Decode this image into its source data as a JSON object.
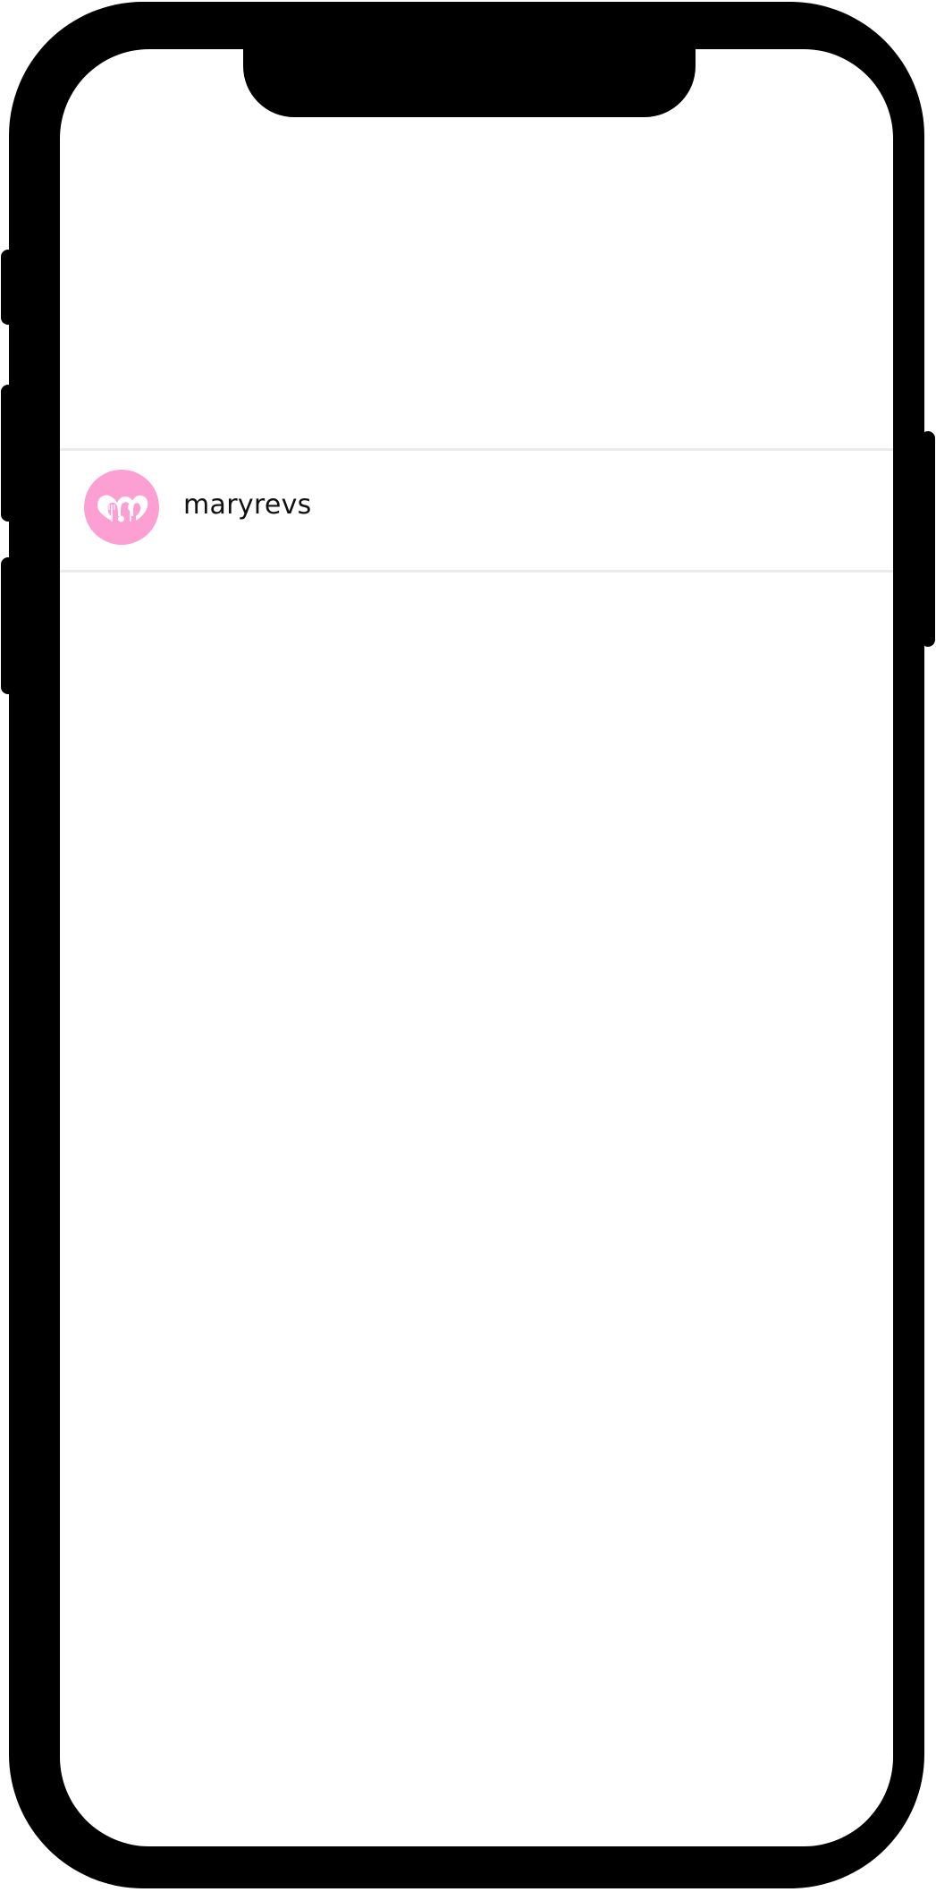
{
  "device": {
    "frame_color": "#000000",
    "screen_color": "#ffffff"
  },
  "account_list": {
    "items": [
      {
        "username": "maryrevs",
        "avatar_icon": "m-heart-utensils-logo-icon",
        "avatar_color": "#fc9fd3",
        "divider_color": "#ebebeb"
      }
    ]
  }
}
